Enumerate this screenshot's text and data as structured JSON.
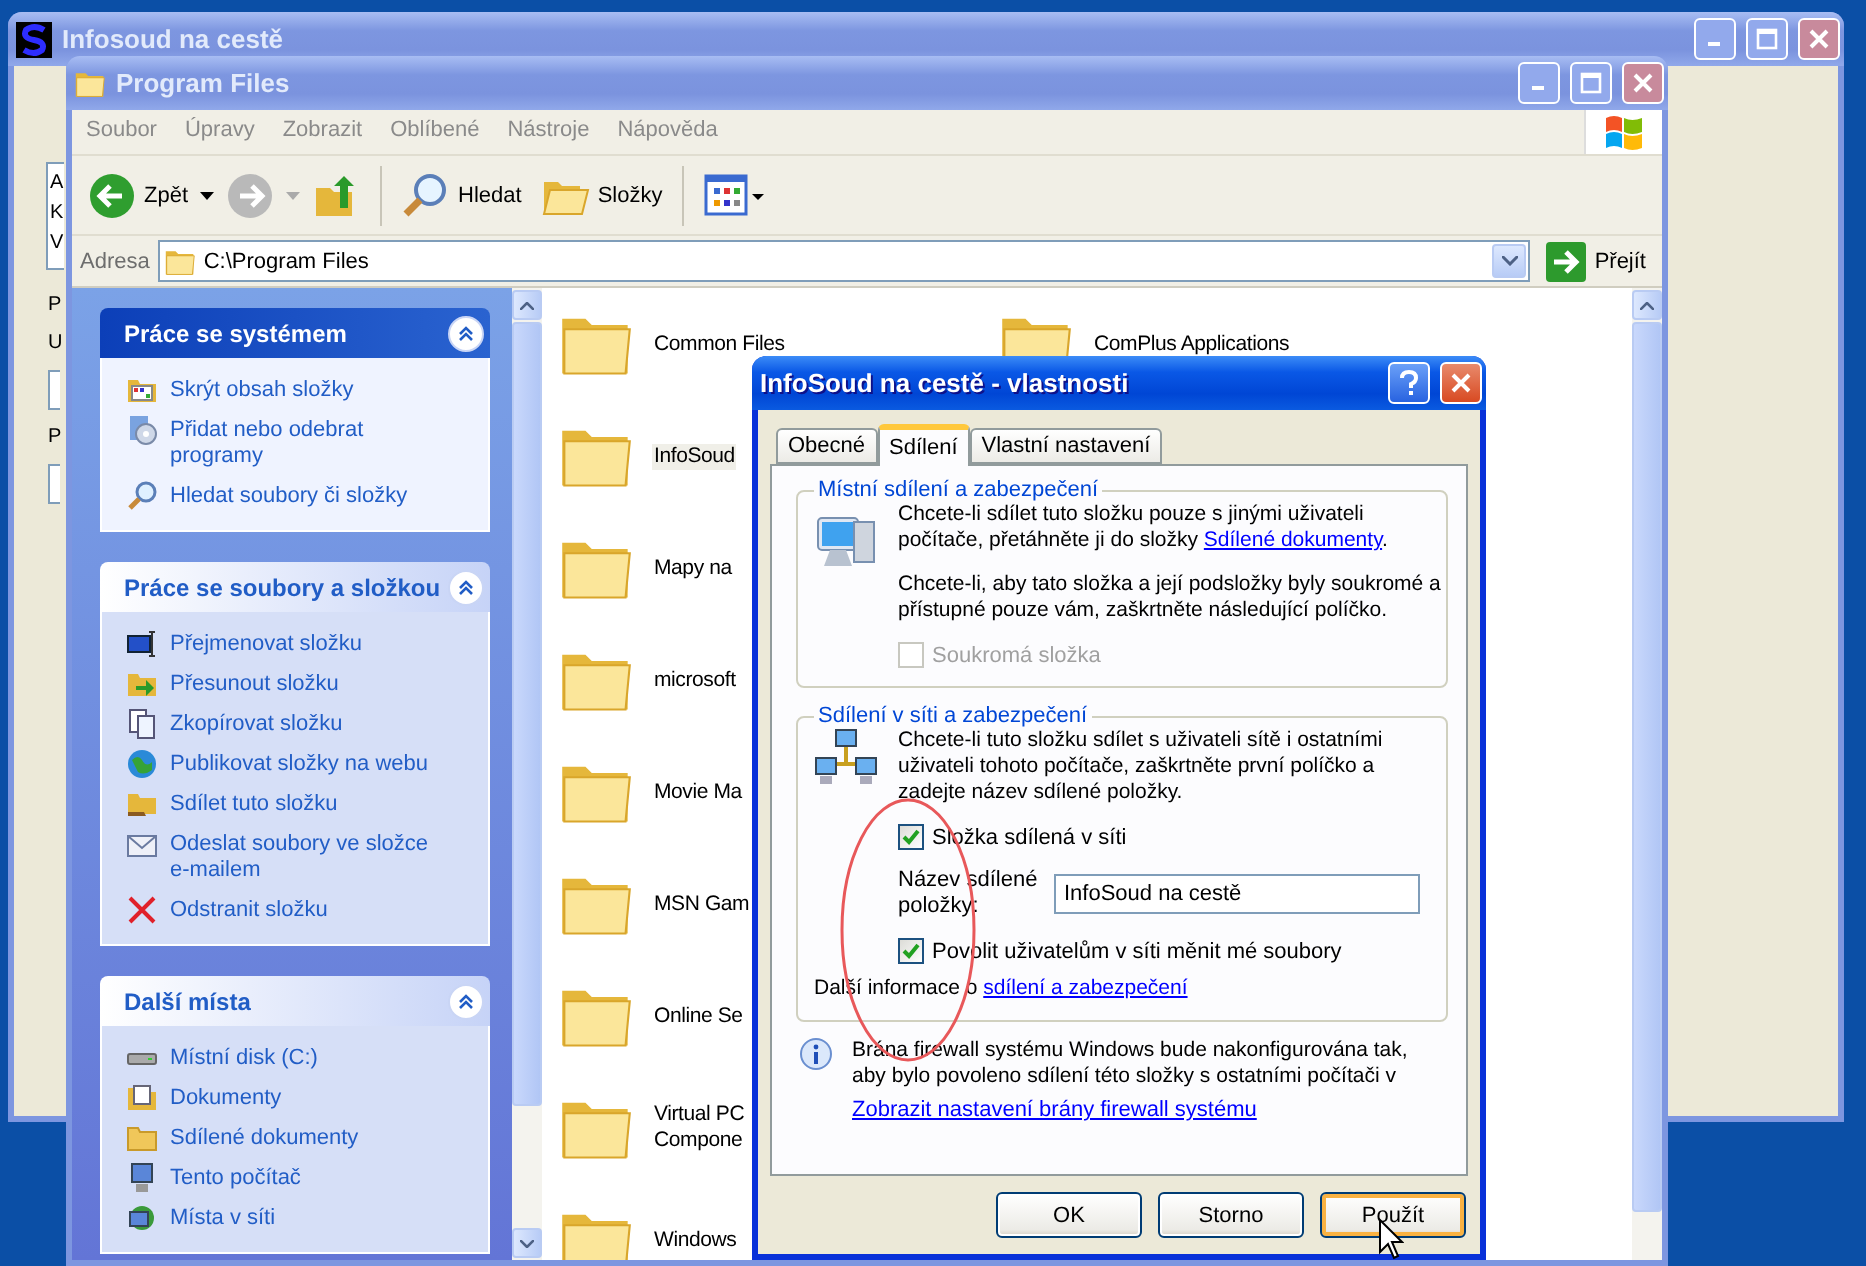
{
  "back_window": {
    "title": "Infosoud na cestě",
    "list_items": [
      "A",
      "K",
      "V"
    ],
    "group_title": "P",
    "labels": [
      "U",
      "P"
    ]
  },
  "explorer": {
    "title": "Program Files",
    "menu": [
      "Soubor",
      "Úpravy",
      "Zobrazit",
      "Oblíbené",
      "Nástroje",
      "Nápověda"
    ],
    "toolbar": {
      "back": "Zpět",
      "forward_disabled": true,
      "search": "Hledat",
      "folders": "Složky"
    },
    "address": {
      "label": "Adresa",
      "value": "C:\\Program Files",
      "go": "Přejít"
    },
    "task_panes": [
      {
        "title": "Práce se systémem",
        "kind": "special",
        "items": [
          {
            "label": "Skrýt obsah složky",
            "kind": "hide"
          },
          {
            "label": "Přidat nebo odebrat programy",
            "kind": "programs"
          },
          {
            "label": "Hledat soubory či složky",
            "kind": "search"
          }
        ]
      },
      {
        "title": "Práce se soubory a složkou",
        "kind": "normal",
        "items": [
          {
            "label": "Přejmenovat složku",
            "kind": "rename"
          },
          {
            "label": "Přesunout složku",
            "kind": "move"
          },
          {
            "label": "Zkopírovat složku",
            "kind": "copy"
          },
          {
            "label": "Publikovat složky na webu",
            "kind": "web"
          },
          {
            "label": "Sdílet tuto složku",
            "kind": "share"
          },
          {
            "label": "Odeslat soubory ve složce e-mailem",
            "kind": "mail"
          },
          {
            "label": "Odstranit složku",
            "kind": "delete"
          }
        ]
      },
      {
        "title": "Další místa",
        "kind": "normal",
        "items": [
          {
            "label": "Místní disk (C:)",
            "kind": "disk"
          },
          {
            "label": "Dokumenty",
            "kind": "documents"
          },
          {
            "label": "Sdílené dokumenty",
            "kind": "folder"
          },
          {
            "label": "Tento počítač",
            "kind": "computer"
          },
          {
            "label": "Místa v síti",
            "kind": "network"
          }
        ]
      }
    ],
    "files": {
      "column_1": [
        {
          "name": "Common Files",
          "selected": false
        },
        {
          "name": "InfoSoud",
          "selected": true
        },
        {
          "name": "Mapy na",
          "selected": false
        },
        {
          "name": "microsoft",
          "selected": false
        },
        {
          "name": "Movie Ma",
          "selected": false
        },
        {
          "name": "MSN Gam",
          "selected": false
        },
        {
          "name": "Online Se",
          "selected": false
        },
        {
          "name": "Virtual PC\nCompone",
          "selected": false
        },
        {
          "name": "Windows",
          "selected": false
        }
      ],
      "column_2": [
        {
          "name": "ComPlus Applications",
          "selected": false
        }
      ]
    }
  },
  "dialog": {
    "title": "InfoSoud na cestě - vlastnosti",
    "tabs": [
      {
        "label": "Obecné",
        "selected": false
      },
      {
        "label": "Sdílení",
        "selected": true
      },
      {
        "label": "Vlastní nastavení",
        "selected": false
      }
    ],
    "local": {
      "title": "Místní sdílení a zabezpečení",
      "text": "Chcete-li sdílet tuto složku pouze s jinými uživateli počítače, přetáhněte ji do složky ",
      "link": "Sdílené dokumenty",
      "text_end": ".",
      "private_text": "Chcete-li, aby tato složka a její podsložky byly soukromé a přístupné pouze vám, zaškrtněte následující políčko.",
      "private_checkbox": {
        "label": "Soukromá složka",
        "checked": false,
        "disabled": true
      }
    },
    "network": {
      "title": "Sdílení v síti a zabezpečení",
      "text": "Chcete-li tuto složku sdílet s uživateli sítě i ostatními uživateli tohoto počítače, zaškrtněte první políčko a zadejte název sdílené položky.",
      "share_checkbox": {
        "label": "Složka sdílená v síti",
        "checked": true,
        "disabled": false
      },
      "share_name_label": "Název sdílené položky:",
      "share_name": "InfoSoud na cestě",
      "write_checkbox": {
        "label": "Povolit uživatelům v síti měnit mé soubory",
        "checked": true,
        "disabled": false
      },
      "more_info": "Další informace o ",
      "more_info_link": "sdílení a zabezpečení"
    },
    "firewall": {
      "text": "Brána firewall systému Windows bude nakonfigurována tak, aby bylo povoleno sdílení této složky s ostatními počítači v",
      "link": "Zobrazit nastavení brány firewall systému"
    },
    "buttons": [
      {
        "label": "OK",
        "hot": false
      },
      {
        "label": "Storno",
        "hot": false
      },
      {
        "label": "Použít",
        "hot": true
      }
    ]
  }
}
